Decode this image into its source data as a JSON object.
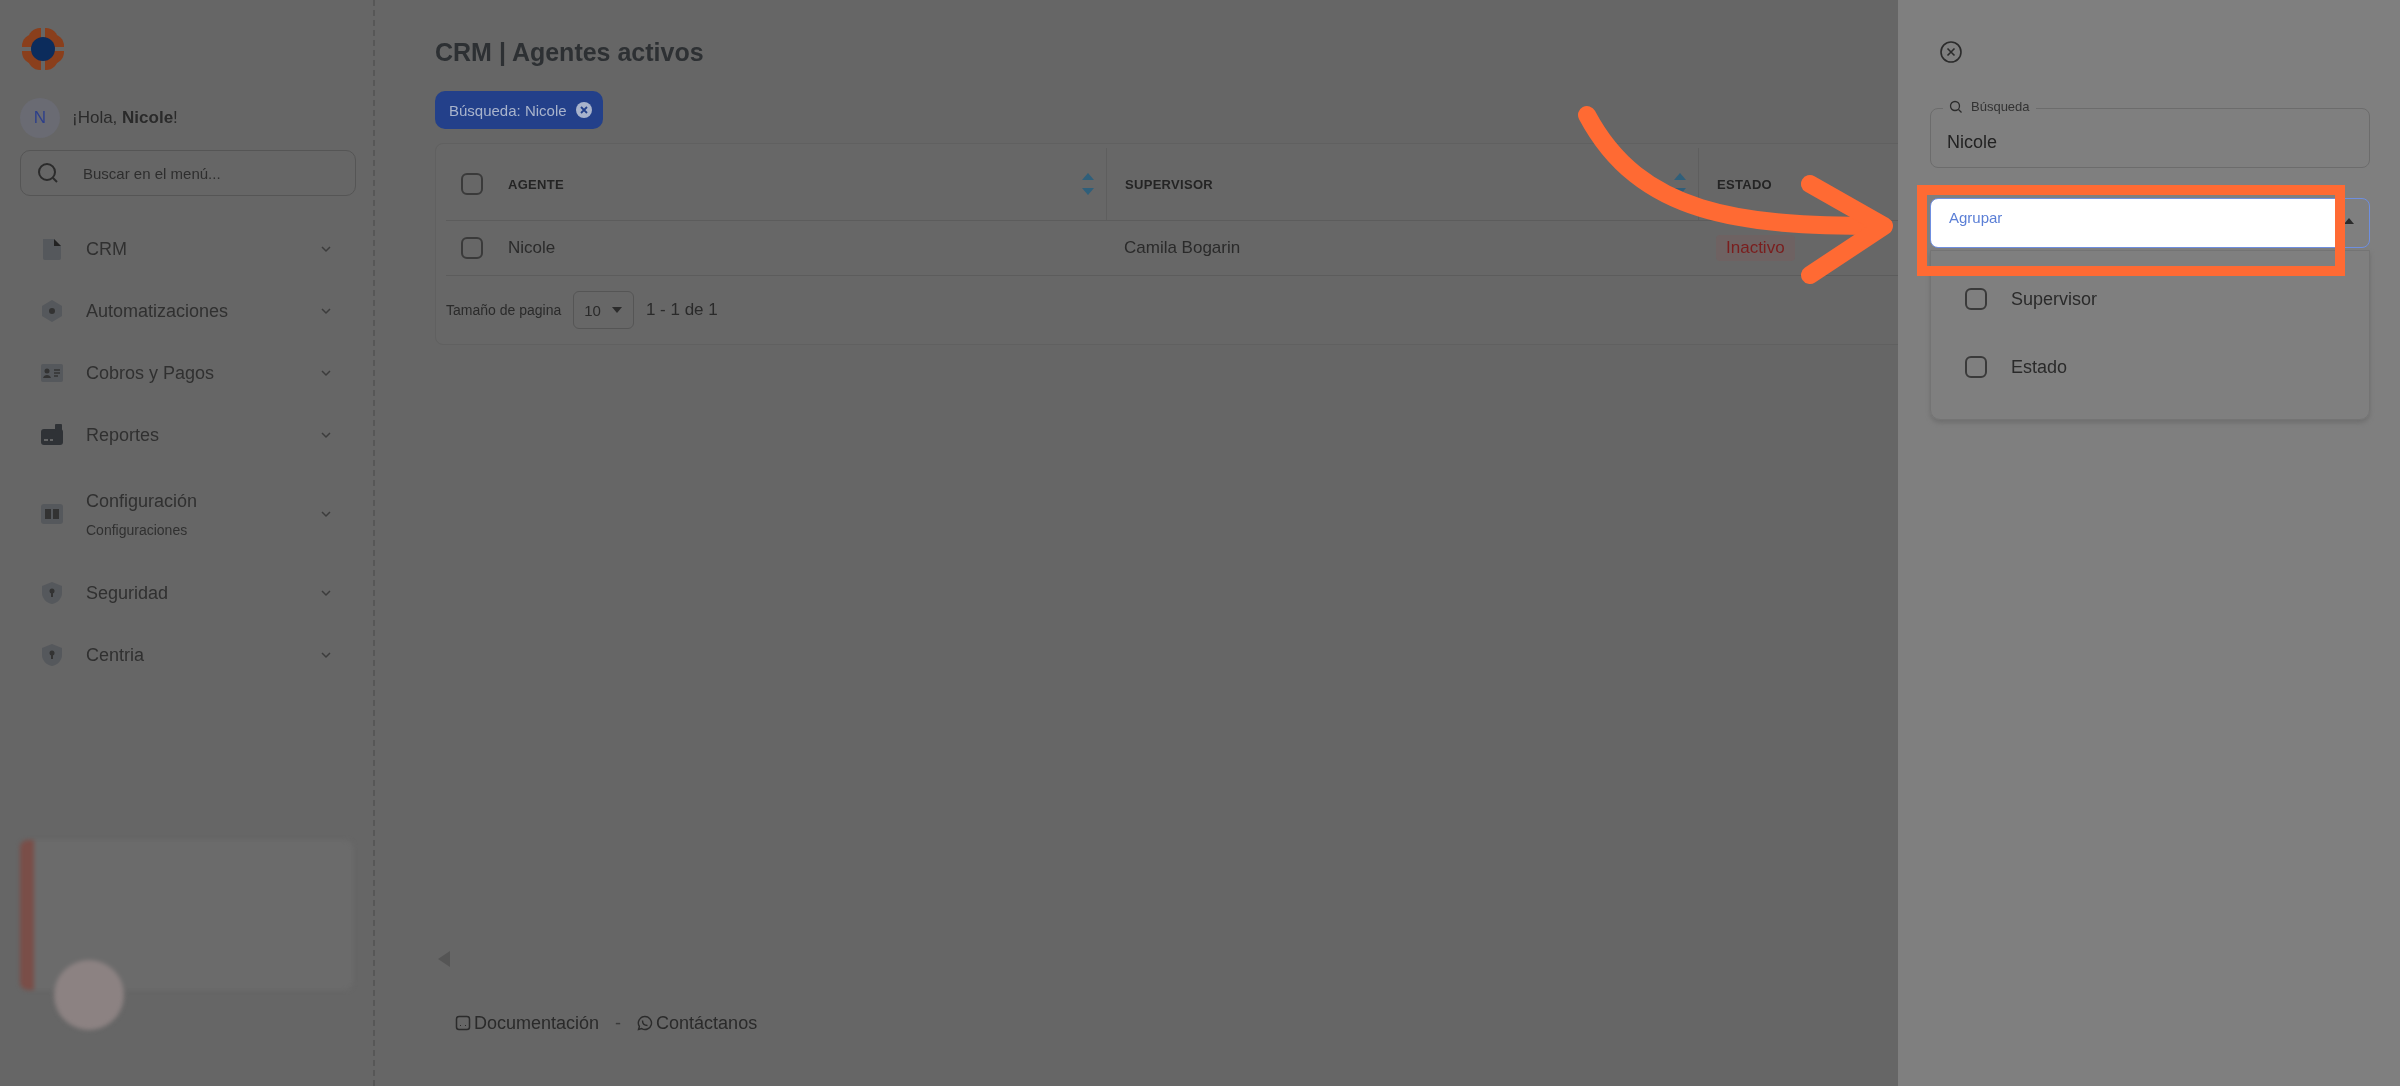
{
  "sidebar": {
    "greeting": {
      "avatar": "N",
      "text": "¡Hola, **Nicole**!"
    },
    "search": {
      "placeholder": "Buscar en el menú..."
    },
    "items": [
      {
        "kind": "doc",
        "label": "CRM",
        "expanded": false
      },
      {
        "kind": "hex",
        "label": "Automatizaciones",
        "expanded": false
      },
      {
        "kind": "card",
        "label": "Cobros y Pagos",
        "expanded": false
      },
      {
        "kind": "wallet",
        "label": "Reportes",
        "expanded": false
      },
      {
        "kind": "book",
        "label": "Configuración",
        "sublabel": "Configuraciones",
        "expanded": false
      },
      {
        "kind": "shield",
        "label": "Seguridad",
        "expanded": false
      },
      {
        "kind": "shield",
        "label": "Centria",
        "expanded": false
      }
    ]
  },
  "main": {
    "title": "CRM | Agentes activos",
    "filter_chips": [
      {
        "label": "Búsqueda: Nicole"
      }
    ],
    "table": {
      "select_all": {
        "checked": false
      },
      "columns": [
        {
          "label": "AGENTE",
          "sortable": true
        },
        {
          "label": "SUPERVISOR",
          "sortable": true
        },
        {
          "label": "ESTADO",
          "sortable": false
        }
      ],
      "rows": [
        {
          "selected": false,
          "cells": [
            {
              "kind": "text",
              "text": "Nicole"
            },
            {
              "kind": "text",
              "text": "Camila Bogarin"
            },
            {
              "kind": "badge",
              "text": "Inactivo"
            }
          ]
        }
      ]
    },
    "pagination": {
      "label": "Tamaño de pagina",
      "page_size": "10",
      "range": "1 - 1 de 1"
    },
    "footer": {
      "links": [
        {
          "kind": "doc",
          "label": "Documentación"
        },
        {
          "kind": "chat",
          "label": "Contáctanos"
        }
      ],
      "separator": "-"
    }
  },
  "panel": {
    "search": {
      "label": "Búsqueda",
      "value": "Nicole"
    },
    "group": {
      "label": "Agrupar",
      "expanded": true,
      "options": [
        {
          "label": "Supervisor",
          "checked": false
        },
        {
          "label": "Estado",
          "checked": false
        }
      ]
    }
  }
}
